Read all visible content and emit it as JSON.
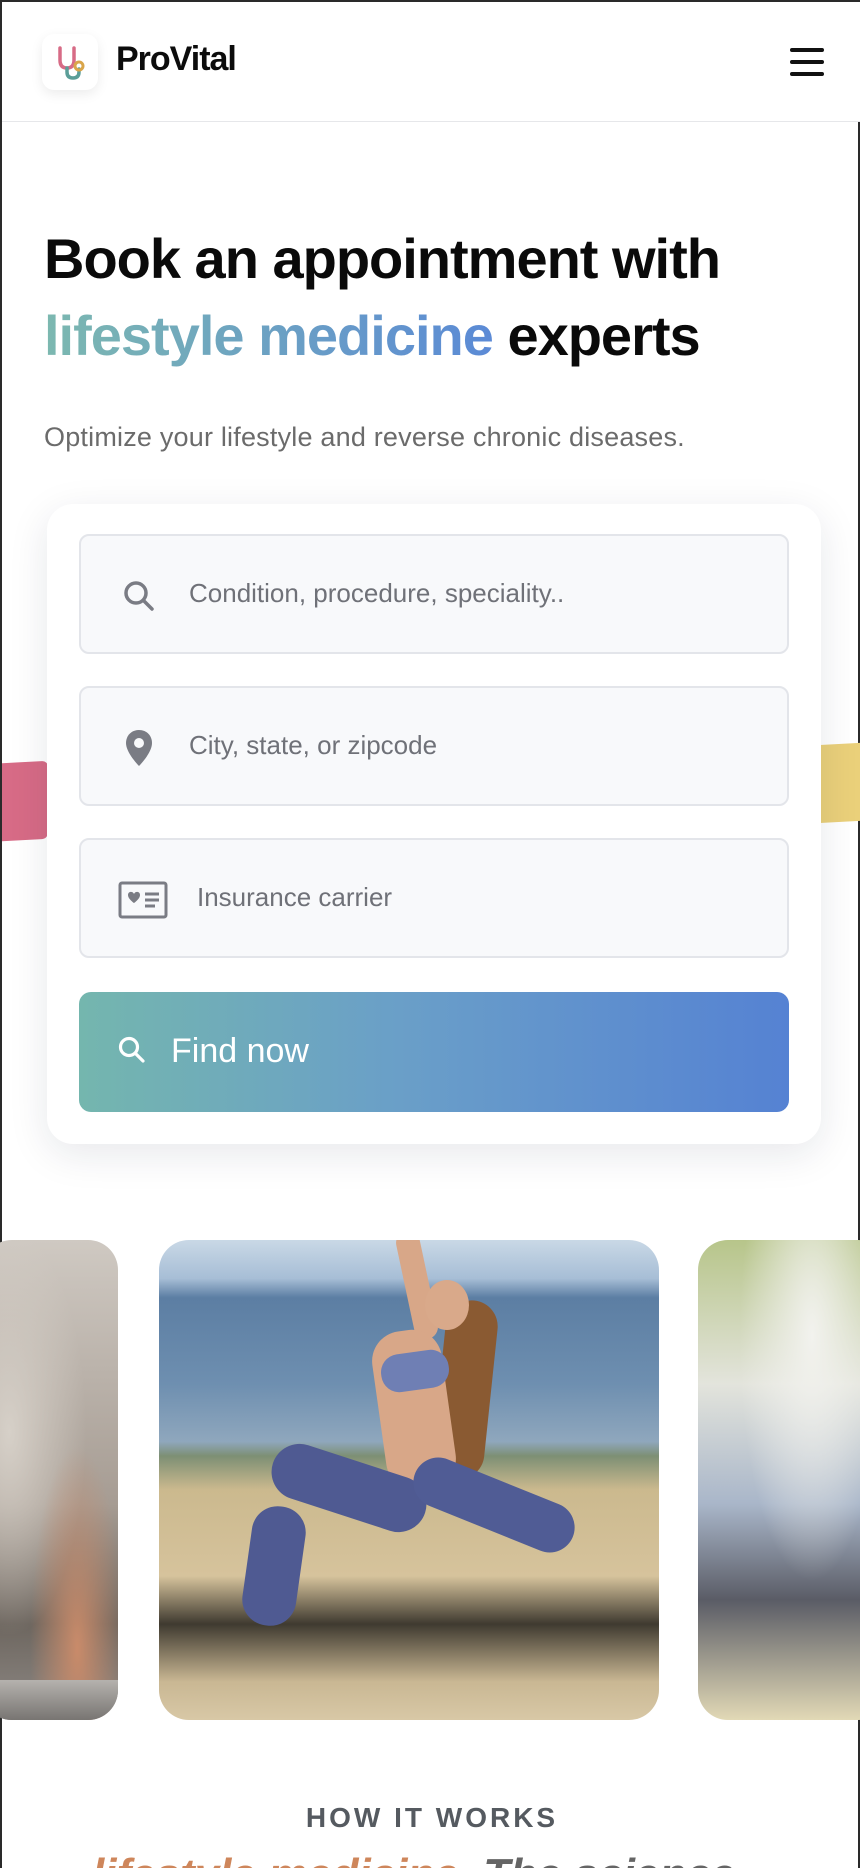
{
  "header": {
    "brand": "ProVital",
    "logo_icon": "stethoscope-icon",
    "menu_icon": "hamburger-menu-icon"
  },
  "hero": {
    "title_line1": "Book an appointment with",
    "title_accent": "lifestyle medicine",
    "title_end": "experts",
    "subtitle": "Optimize your lifestyle and reverse chronic diseases."
  },
  "search": {
    "condition": {
      "placeholder": "Condition, procedure, speciality..",
      "icon": "search-icon"
    },
    "location": {
      "placeholder": "City, state, or zipcode",
      "icon": "map-pin-icon"
    },
    "insurance": {
      "placeholder": "Insurance carrier",
      "icon": "insurance-card-icon"
    },
    "button_label": "Find now",
    "button_icon": "search-icon"
  },
  "gallery": {
    "images": [
      "cooking-photo",
      "yoga-beach-photo",
      "gardening-photo"
    ]
  },
  "how_it_works": {
    "heading": "HOW IT WORKS",
    "peek_colored": "lifestyle medicine.",
    "peek_dark": "The science"
  },
  "colors": {
    "accent_start": "#74b6ae",
    "accent_end": "#5582d3",
    "deco_pink": "#d76b86",
    "deco_yellow": "#ead07a"
  }
}
